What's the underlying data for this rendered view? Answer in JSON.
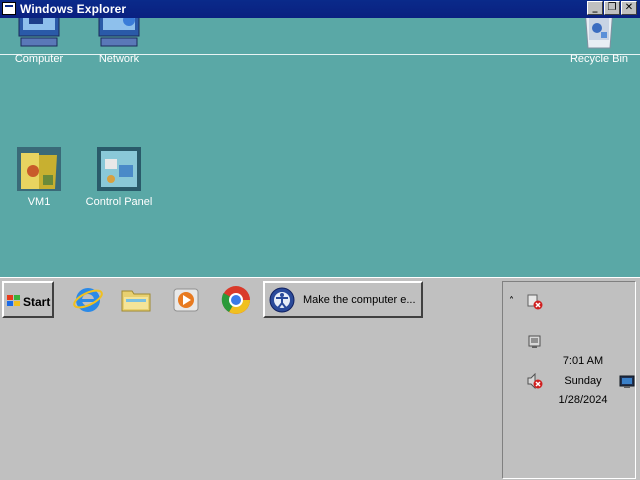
{
  "window": {
    "title": "Windows Explorer"
  },
  "desktop": {
    "icons": [
      {
        "label": "Computer",
        "icon": "computer-icon"
      },
      {
        "label": "Network",
        "icon": "network-icon"
      },
      {
        "label": "Recycle Bin",
        "icon": "recycle-bin-icon"
      },
      {
        "label": "VM1",
        "icon": "folder-icon"
      },
      {
        "label": "Control Panel",
        "icon": "control-panel-icon"
      }
    ]
  },
  "taskbar": {
    "start_label": "Start",
    "quick_launch": [
      {
        "icon": "internet-explorer-icon"
      },
      {
        "icon": "file-explorer-icon"
      },
      {
        "icon": "media-player-icon"
      },
      {
        "icon": "chrome-icon"
      }
    ],
    "task": {
      "label": "Make the computer e...",
      "icon": "ease-of-access-icon"
    }
  },
  "tray": {
    "time": "7:01 AM",
    "day": "Sunday",
    "date": "1/28/2024",
    "icons": [
      "show-hidden-icons-chevron",
      "network-error-icon",
      "action-center-icon",
      "volume-muted-icon",
      "display-icon"
    ]
  },
  "colors": {
    "desktop": "#5aa8a6",
    "titlebar": "#0a2a8a",
    "taskbar": "#c0c0c0"
  }
}
